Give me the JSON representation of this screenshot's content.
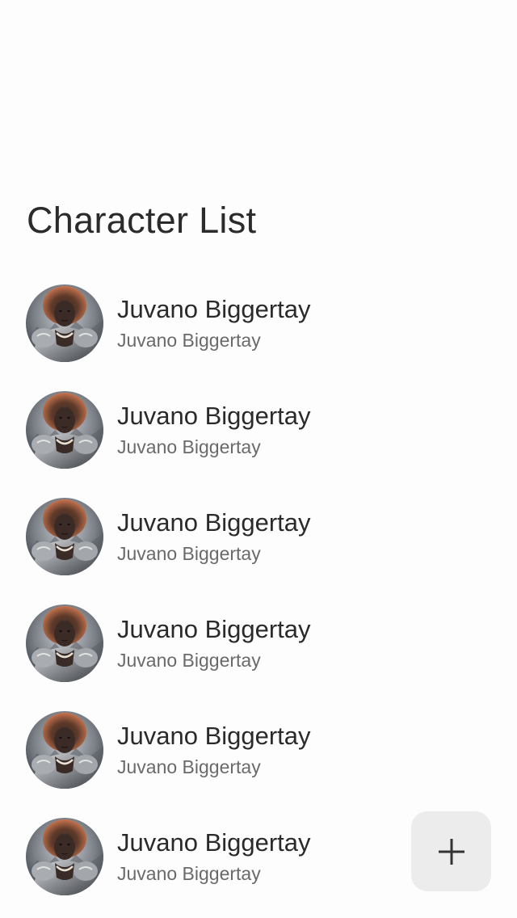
{
  "page": {
    "title": "Character List"
  },
  "characters": [
    {
      "name": "Juvano Biggertay",
      "subtitle": "Juvano Biggertay",
      "avatar_icon": "character-portrait"
    },
    {
      "name": "Juvano Biggertay",
      "subtitle": "Juvano Biggertay",
      "avatar_icon": "character-portrait"
    },
    {
      "name": "Juvano Biggertay",
      "subtitle": "Juvano Biggertay",
      "avatar_icon": "character-portrait"
    },
    {
      "name": "Juvano Biggertay",
      "subtitle": "Juvano Biggertay",
      "avatar_icon": "character-portrait"
    },
    {
      "name": "Juvano Biggertay",
      "subtitle": "Juvano Biggertay",
      "avatar_icon": "character-portrait"
    },
    {
      "name": "Juvano Biggertay",
      "subtitle": "Juvano Biggertay",
      "avatar_icon": "character-portrait"
    }
  ],
  "fab": {
    "icon": "plus-icon"
  },
  "colors": {
    "background": "#fdfdfd",
    "title_text": "#2b2b2b",
    "subtitle_text": "#6a6a6a",
    "fab_background": "#ececec"
  }
}
